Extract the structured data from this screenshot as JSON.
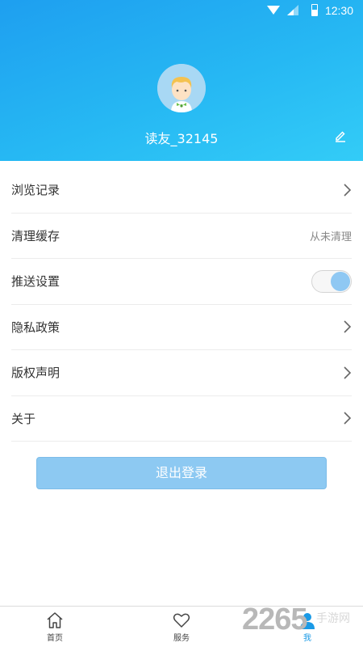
{
  "status_bar": {
    "time": "12:30"
  },
  "profile": {
    "username": "读友_32145"
  },
  "menu": {
    "items": [
      {
        "label": "浏览记录"
      },
      {
        "label": "清理缓存",
        "right_text": "从未清理"
      },
      {
        "label": "推送设置",
        "toggle_on": true
      },
      {
        "label": "隐私政策"
      },
      {
        "label": "版权声明"
      },
      {
        "label": "关于"
      }
    ]
  },
  "logout_label": "退出登录",
  "tabbar": {
    "tabs": [
      {
        "label": "首页",
        "icon": "home-icon"
      },
      {
        "label": "服务",
        "icon": "heart-icon"
      },
      {
        "label": "我",
        "icon": "person-icon",
        "active": true
      }
    ]
  },
  "watermark": {
    "number": "2265",
    "text": "手游网"
  },
  "colors": {
    "accent": "#1a9ae6",
    "header_start": "#1e9ff0",
    "header_end": "#33ccf7",
    "button": "#8dc9f2"
  }
}
